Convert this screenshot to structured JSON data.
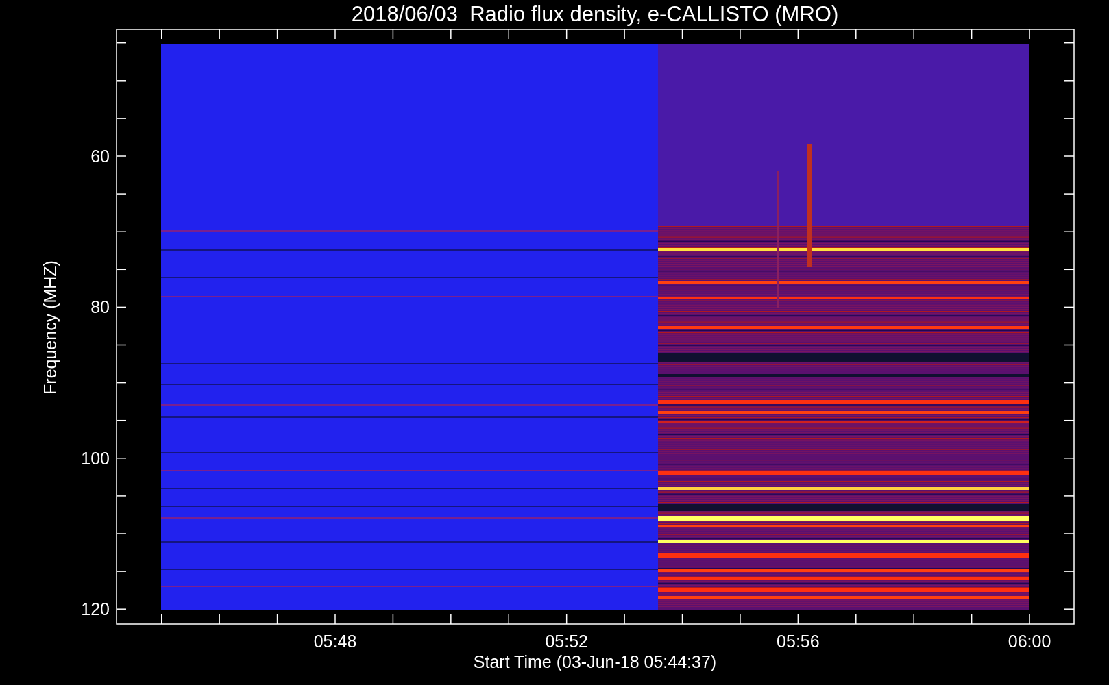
{
  "title": "2018/06/03  Radio flux density, e-CALLISTO (MRO)",
  "ylabel": "Frequency (MHZ)",
  "xlabel": "Start Time (03-Jun-18 05:44:37)",
  "yticks": [
    "60",
    "80",
    "100",
    "120"
  ],
  "xticks": [
    "05:48",
    "05:52",
    "05:56",
    "06:00"
  ]
}
